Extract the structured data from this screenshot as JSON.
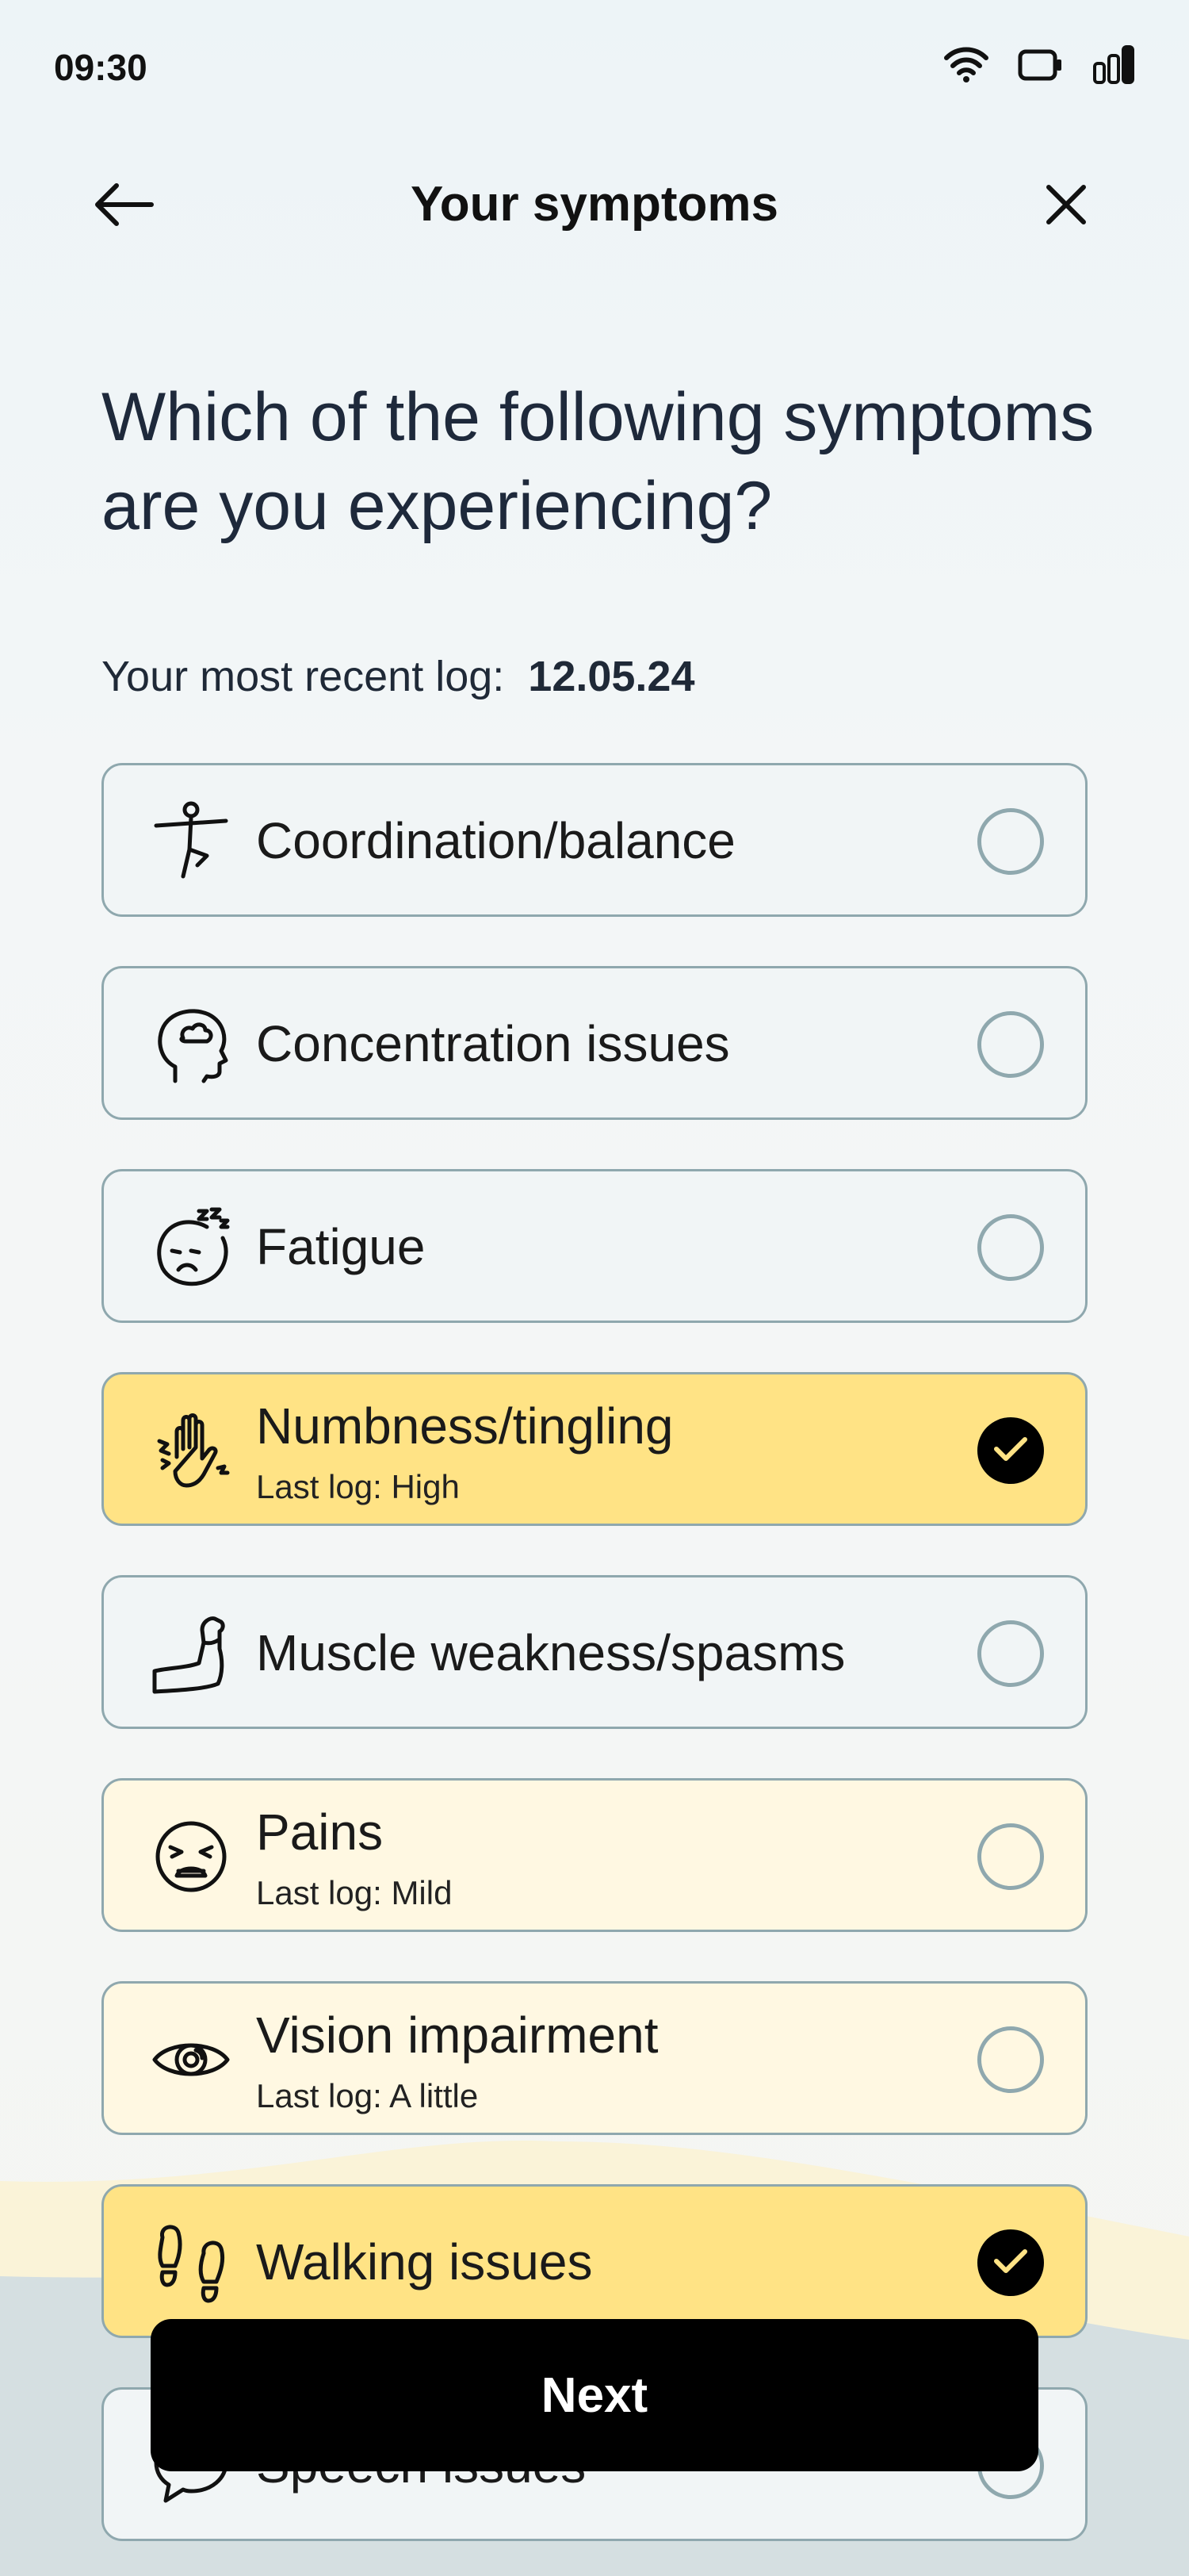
{
  "status_bar": {
    "time": "09:30",
    "icons": [
      "wifi-icon",
      "battery-icon",
      "signal-icon"
    ]
  },
  "header": {
    "title": "Your symptoms",
    "back_icon": "arrow-left-icon",
    "close_icon": "close-icon"
  },
  "question": "Which of the following symptoms are you experiencing?",
  "recent_log": {
    "label": "Your most recent log:",
    "date": "12.05.24"
  },
  "symptoms": [
    {
      "label": "Coordination/balance",
      "sub": "",
      "icon": "balance-person-icon",
      "selected": false,
      "highlight": "none"
    },
    {
      "label": "Concentration issues",
      "sub": "",
      "icon": "head-cloud-icon",
      "selected": false,
      "highlight": "none"
    },
    {
      "label": "Fatigue",
      "sub": "",
      "icon": "sleepy-face-icon",
      "selected": false,
      "highlight": "none"
    },
    {
      "label": "Numbness/tingling",
      "sub": "Last log: High",
      "icon": "tingling-hand-icon",
      "selected": true,
      "highlight": "strong"
    },
    {
      "label": "Muscle weakness/spasms",
      "sub": "",
      "icon": "flexed-arm-icon",
      "selected": false,
      "highlight": "none"
    },
    {
      "label": "Pains",
      "sub": "Last log: Mild",
      "icon": "pained-face-icon",
      "selected": false,
      "highlight": "pale"
    },
    {
      "label": "Vision impairment",
      "sub": "Last log: A little",
      "icon": "eye-icon",
      "selected": false,
      "highlight": "pale"
    },
    {
      "label": "Walking issues",
      "sub": "",
      "icon": "footprints-icon",
      "selected": true,
      "highlight": "strong"
    },
    {
      "label": "Speech issues",
      "sub": "",
      "icon": "speech-bubble-icon",
      "selected": false,
      "highlight": "none"
    }
  ],
  "next_button": {
    "label": "Next"
  },
  "colors": {
    "selected": "#ffe385",
    "pale": "#fff8e2",
    "border": "#8fa8ae",
    "button": "#000000"
  }
}
